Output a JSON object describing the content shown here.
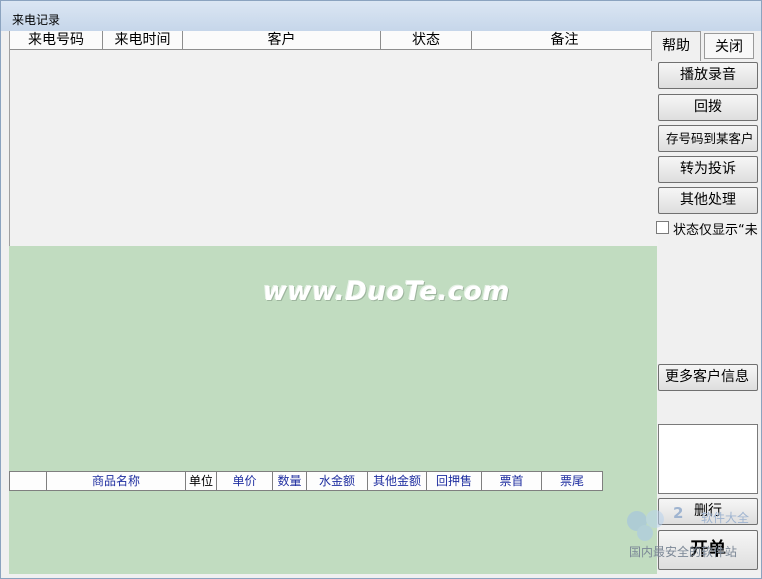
{
  "window": {
    "title": "来电记录"
  },
  "call_table": {
    "columns": [
      "来电号码",
      "来电时间",
      "客户",
      "状态",
      "备注"
    ]
  },
  "watermark": "www.DuoTe.com",
  "items_table": {
    "columns": [
      "",
      "商品名称",
      "单位",
      "单价",
      "数量",
      "水金额",
      "其他金额",
      "回押售",
      "票首",
      "票尾"
    ]
  },
  "tabs": {
    "help": "帮助",
    "close": "关闭"
  },
  "buttons": {
    "play_recording": "播放录音",
    "callback": "回拨",
    "save_number": "存号码到某客户",
    "to_complaint": "转为投诉",
    "other_process": "其他处理",
    "more_customer_info": "更多客户信息",
    "delete_row": "删行",
    "open_order": "开单"
  },
  "filter": {
    "label": "状态仅显示“未",
    "checked": false
  },
  "logo": {
    "number": "2",
    "text": "软件大全",
    "subtitle": "国内最安全的软件站"
  }
}
